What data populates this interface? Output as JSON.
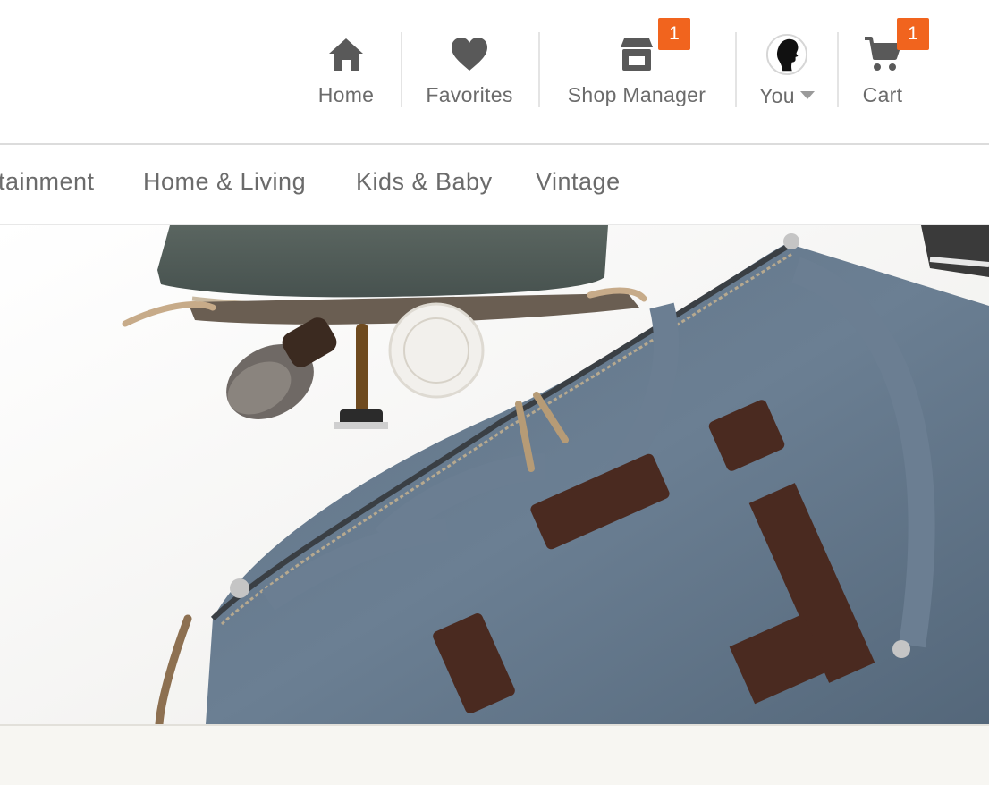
{
  "header": {
    "nav": [
      {
        "label": "Home",
        "icon": "home-icon"
      },
      {
        "label": "Favorites",
        "icon": "heart-icon"
      },
      {
        "label": "Shop Manager",
        "icon": "shop-icon",
        "badge": "1"
      },
      {
        "label": "You",
        "icon": "avatar"
      },
      {
        "label": "Cart",
        "icon": "cart-icon",
        "badge": "1"
      }
    ]
  },
  "categories": [
    {
      "label": "tainment"
    },
    {
      "label": "Home & Living"
    },
    {
      "label": "Kids & Baby"
    },
    {
      "label": "Vintage"
    }
  ],
  "colors": {
    "badge": "#f1641e",
    "icon": "#595959",
    "text": "#6b6b6b"
  }
}
